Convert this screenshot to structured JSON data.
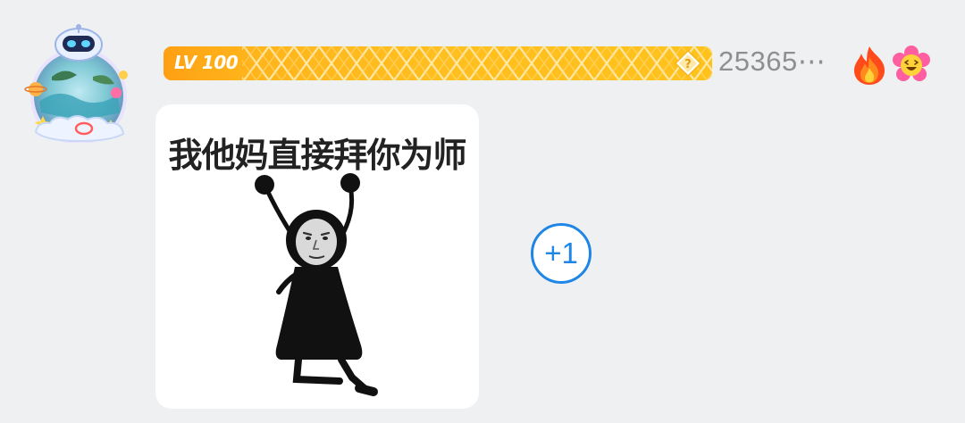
{
  "message": {
    "level_label": "LV 100",
    "username": "25365⋯",
    "sticker_caption": "我他妈直接拜你为师",
    "plus_one_label": "+1"
  },
  "icons": {
    "avatar": "robot-avatar-with-frame",
    "level_diamond": "diamond-question-icon",
    "badge_1": "fire-icon",
    "badge_2": "laughing-flower-icon"
  },
  "colors": {
    "level_bar": "#ffb71d",
    "plus_one": "#1f86e6",
    "username": "#8f8f8f",
    "background": "#eef0f1"
  }
}
